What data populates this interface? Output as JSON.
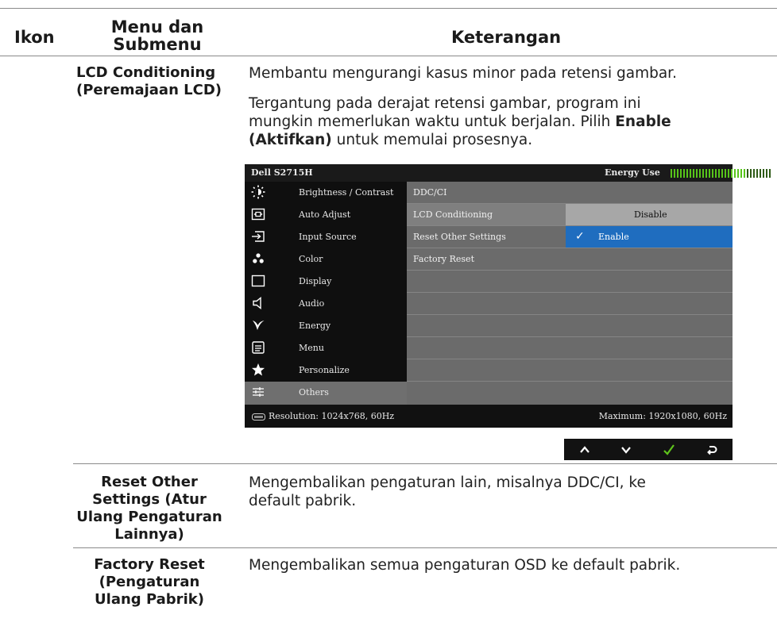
{
  "header": {
    "col_icon": "Ikon",
    "col_menu_line1": "Menu dan",
    "col_menu_line2": "Submenu",
    "col_desc": "Keterangan"
  },
  "rows": [
    {
      "label_line1": "LCD Conditioning",
      "label_line2": "(Peremajaan LCD)",
      "desc1": "Membantu mengurangi kasus minor pada retensi gambar.",
      "desc2_line1": "Tergantung pada derajat retensi gambar, program ini",
      "desc2_line2_pre": "mungkin memerlukan waktu untuk berjalan. Pilih ",
      "desc2_line2_bold": "Enable",
      "desc2_line3_bold": "(Aktifkan)",
      "desc2_line3_post": " untuk memulai prosesnya."
    },
    {
      "label_line1": "Reset Other",
      "label_line2": "Settings (Atur",
      "label_line3": "Ulang Pengaturan",
      "label_line4": "Lainnya)",
      "desc_line1": "Mengembalikan pengaturan lain, misalnya DDC/CI, ke",
      "desc_line2": "default pabrik."
    },
    {
      "label_line1": "Factory Reset",
      "label_line2": "(Pengaturan",
      "label_line3": "Ulang Pabrik)",
      "desc_line1": "Mengembalikan semua pengaturan OSD ke default pabrik."
    }
  ],
  "osd": {
    "model": "Dell S2715H",
    "energy_label": "Energy Use",
    "energy_level": 0.75,
    "menu": [
      {
        "label": "Brightness / Contrast",
        "icon": "brightness-icon"
      },
      {
        "label": "Auto Adjust",
        "icon": "auto-adjust-icon"
      },
      {
        "label": "Input Source",
        "icon": "input-source-icon"
      },
      {
        "label": "Color",
        "icon": "color-icon"
      },
      {
        "label": "Display",
        "icon": "display-icon"
      },
      {
        "label": "Audio",
        "icon": "speaker-icon"
      },
      {
        "label": "Energy",
        "icon": "energy-icon"
      },
      {
        "label": "Menu",
        "icon": "menu-icon"
      },
      {
        "label": "Personalize",
        "icon": "star-icon"
      },
      {
        "label": "Others",
        "icon": "others-icon"
      }
    ],
    "selected_menu": "Others",
    "submenu": [
      "DDC/CI",
      "LCD Conditioning",
      "Reset Other Settings",
      "Factory Reset"
    ],
    "options": {
      "disable": "Disable",
      "enable": "Enable",
      "selected": "Enable"
    },
    "resolution": "Resolution: 1024x768, 60Hz",
    "maximum": "Maximum: 1920x1080, 60Hz",
    "colors": {
      "highlight_blue": "#1f6dbf",
      "energy_green": "#57c41a",
      "check_green": "#5fc41c"
    }
  },
  "nav_buttons": [
    "up-icon",
    "down-icon",
    "check-icon",
    "back-icon"
  ]
}
